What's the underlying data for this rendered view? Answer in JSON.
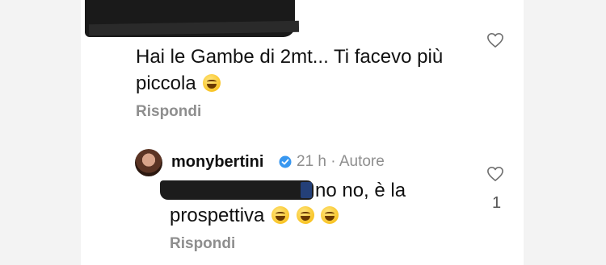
{
  "comment_1": {
    "text": "Hai le Gambe di 2mt... Ti facevo più piccola",
    "reply_label": "Rispondi"
  },
  "comment_2": {
    "username": "monybertini",
    "time": "21 h",
    "separator": "·",
    "author_tag": "Autore",
    "text_line1": "no no, è la",
    "text_line2": "prospettiva",
    "reply_label": "Rispondi",
    "like_count": "1"
  },
  "colors": {
    "meta_gray": "#8e8e8e",
    "verified_blue": "#3897f0"
  },
  "icons": {
    "like": "heart-outline-icon",
    "verified": "verified-badge-icon",
    "emoji": "face-with-tears-of-joy-emoji"
  }
}
